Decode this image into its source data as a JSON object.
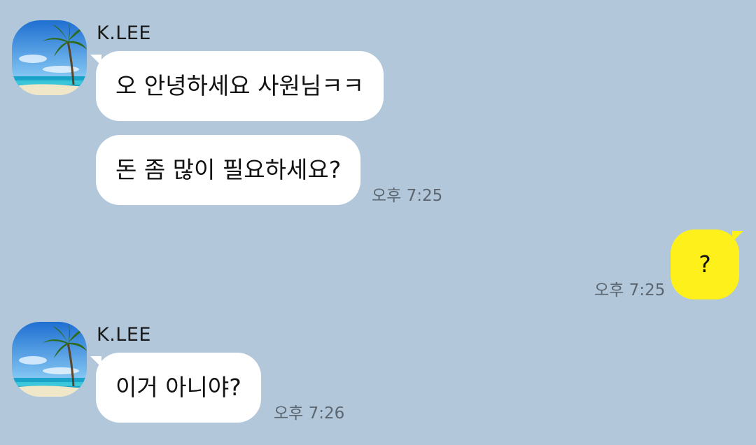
{
  "chat": {
    "groups": [
      {
        "sender": "K.LEE",
        "messages": [
          {
            "text": "오 안녕하세요 사원님ㅋㅋ"
          },
          {
            "text": "돈 좀 많이 필요하세요?",
            "time": "오후 7:25"
          }
        ]
      },
      {
        "outgoing": true,
        "messages": [
          {
            "text": "?",
            "time": "오후 7:25"
          }
        ]
      },
      {
        "sender": "K.LEE",
        "messages": [
          {
            "text": "이거 아니야?",
            "time": "오후 7:26"
          }
        ]
      }
    ]
  },
  "colors": {
    "background": "#b2c7da",
    "incoming_bubble": "#ffffff",
    "outgoing_bubble": "#fef01b",
    "time_text": "#5b6670"
  },
  "icons": {
    "avatar": "palm-beach-profile-picture"
  }
}
